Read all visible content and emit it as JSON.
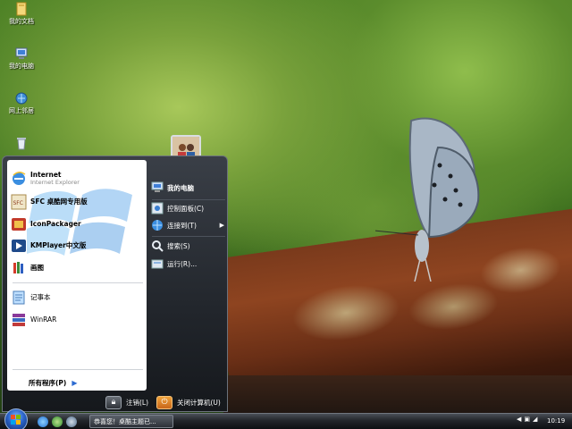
{
  "desktop": {
    "icons": [
      {
        "label": "我的文档",
        "icon": "folder-icon"
      },
      {
        "label": "我的电脑",
        "icon": "computer-icon"
      },
      {
        "label": "网上邻居",
        "icon": "network-icon"
      },
      {
        "label": "",
        "icon": "recycle-bin-icon"
      }
    ]
  },
  "start_menu": {
    "pinned": [
      {
        "label": "Internet",
        "sub": "Internet Explorer",
        "icon": "internet-explorer-icon"
      },
      {
        "label": "SFC 桌酷网专用版",
        "icon": "sfc-icon"
      },
      {
        "label": "IconPackager",
        "icon": "iconpackager-icon"
      },
      {
        "label": "KMPlayer中文版",
        "icon": "kmplayer-icon"
      },
      {
        "label": "画图",
        "icon": "paint-icon"
      }
    ],
    "recent": [
      {
        "label": "记事本",
        "icon": "notepad-icon"
      },
      {
        "label": "WinRAR",
        "icon": "winrar-icon"
      }
    ],
    "all_programs": "所有程序(P)",
    "right": [
      {
        "label": "我的电脑",
        "icon": "my-computer-icon"
      },
      {
        "label": "控制面板(C)",
        "icon": "control-panel-icon"
      },
      {
        "label": "连接到(T)",
        "icon": "connect-to-icon"
      },
      {
        "label": "搜索(S)",
        "icon": "search-icon"
      },
      {
        "label": "运行(R)...",
        "icon": "run-icon"
      }
    ],
    "logoff": "注销(L)",
    "shutdown": "关闭计算机(U)"
  },
  "taskbar": {
    "task_label": "恭喜您！桌酷主题已...",
    "clock": "10:19",
    "tray_icons": [
      "chevron-left-icon",
      "network-tray-icon",
      "volume-icon",
      "display-icon"
    ]
  },
  "colors": {
    "accent": "#2b63c7",
    "menu_bg": "#22262c",
    "taskbar_bg": "#22252a"
  }
}
